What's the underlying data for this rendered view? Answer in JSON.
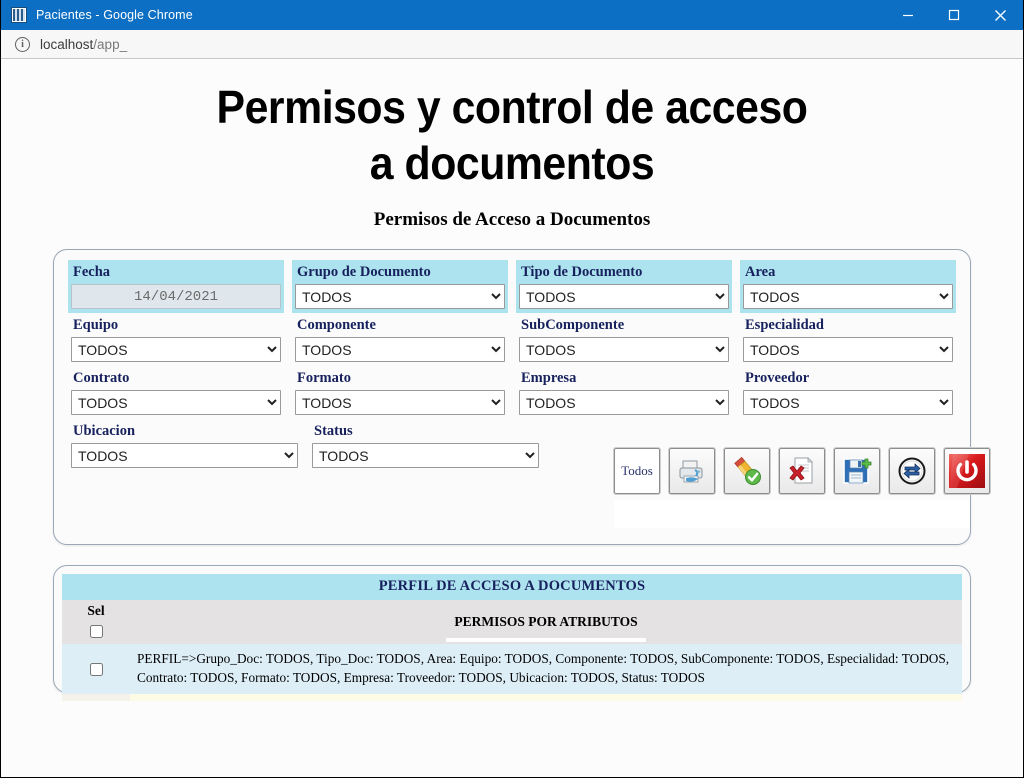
{
  "browser": {
    "title": "Pacientes - Google Chrome",
    "favicon_name": "pacientes-favicon",
    "url": "localhost/app_",
    "url_prefix": "localhost",
    "url_suffix": "/app_",
    "minimize_label": "Minimizar",
    "maximize_label": "Maximizar",
    "close_label": "Cerrar",
    "title_bar_color": "#0c6fc4"
  },
  "page": {
    "main_title_line1": "Permisos y control de acceso",
    "main_title_line2": "a documentos",
    "subtitle": "Permisos de Acceso a Documentos"
  },
  "filters": {
    "row1": [
      {
        "label": "Fecha",
        "type": "date",
        "value": "14/04/2021",
        "highlight": true,
        "name": "fecha"
      },
      {
        "label": "Grupo de Documento",
        "type": "select",
        "value": "TODOS",
        "highlight": true,
        "name": "grupo-de-documento"
      },
      {
        "label": "Tipo de Documento",
        "type": "select",
        "value": "TODOS",
        "highlight": true,
        "name": "tipo-de-documento"
      },
      {
        "label": "Area",
        "type": "select",
        "value": "TODOS",
        "highlight": true,
        "name": "area"
      }
    ],
    "row2": [
      {
        "label": "Equipo",
        "type": "select",
        "value": "TODOS",
        "highlight": false,
        "name": "equipo"
      },
      {
        "label": "Componente",
        "type": "select",
        "value": "TODOS",
        "highlight": false,
        "name": "componente"
      },
      {
        "label": "SubComponente",
        "type": "select",
        "value": "TODOS",
        "highlight": false,
        "name": "subcomponente"
      },
      {
        "label": "Especialidad",
        "type": "select",
        "value": "TODOS",
        "highlight": false,
        "name": "especialidad"
      }
    ],
    "row3": [
      {
        "label": "Contrato",
        "type": "select",
        "value": "TODOS",
        "highlight": false,
        "name": "contrato"
      },
      {
        "label": "Formato",
        "type": "select",
        "value": "TODOS",
        "highlight": false,
        "name": "formato"
      },
      {
        "label": "Empresa",
        "type": "select",
        "value": "TODOS",
        "highlight": false,
        "name": "empresa"
      },
      {
        "label": "Proveedor",
        "type": "select",
        "value": "TODOS",
        "highlight": false,
        "name": "proveedor"
      }
    ],
    "row4": [
      {
        "label": "Ubicacion",
        "type": "select",
        "value": "TODOS",
        "highlight": false,
        "name": "ubicacion"
      },
      {
        "label": "Status",
        "type": "select",
        "value": "TODOS",
        "highlight": false,
        "name": "status"
      }
    ]
  },
  "toolbar": {
    "buttons": [
      {
        "name": "todos-button",
        "icon": "text",
        "label": "Todos"
      },
      {
        "name": "print-button",
        "icon": "printer-icon",
        "label": ""
      },
      {
        "name": "edit-button",
        "icon": "pencil-check-icon",
        "label": ""
      },
      {
        "name": "delete-button",
        "icon": "document-delete-icon",
        "label": ""
      },
      {
        "name": "save-button",
        "icon": "floppy-save-icon",
        "label": ""
      },
      {
        "name": "refresh-button",
        "icon": "refresh-icon",
        "label": ""
      },
      {
        "name": "exit-button",
        "icon": "power-icon",
        "label": ""
      }
    ]
  },
  "table": {
    "title": "PERFIL DE ACCESO A DOCUMENTOS",
    "columns": [
      "Sel",
      "PERMISOS POR ATRIBUTOS"
    ],
    "rows": [
      {
        "selected": false,
        "text": "PERFIL=>Grupo_Doc: TODOS, Tipo_Doc: TODOS, Area: Equipo: TODOS, Componente: TODOS, SubComponente: TODOS, Especialidad: TODOS, Contrato: TODOS, Formato: TODOS, Empresa: Troveedor: TODOS, Ubicacion: TODOS, Status: TODOS"
      }
    ],
    "header_checkbox_name": "select-all-checkbox"
  },
  "colors": {
    "accent_cyan": "#ade3ee",
    "label_navy": "#17215e",
    "row_blue": "#ddeef7",
    "header_gray": "#e4e2e2",
    "chrome_blue": "#0c6fc4"
  }
}
